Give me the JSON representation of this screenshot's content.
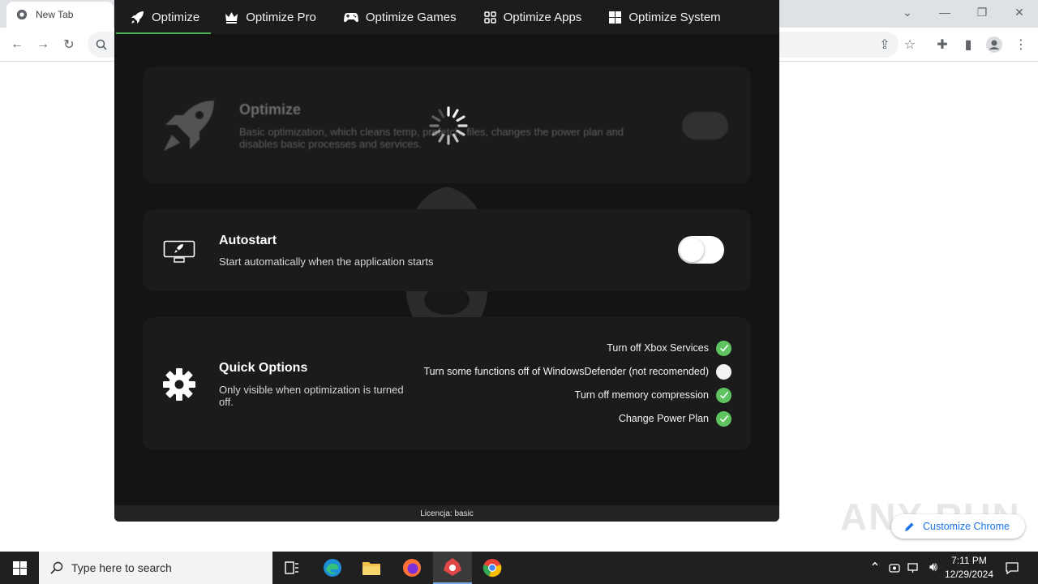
{
  "browser": {
    "tab_title": "New Tab",
    "customize_label": "Customize Chrome",
    "watermark": "ANY RUN"
  },
  "app": {
    "nav": [
      {
        "label": "Optimize",
        "icon": "rocket-icon"
      },
      {
        "label": "Optimize Pro",
        "icon": "crown-icon"
      },
      {
        "label": "Optimize Games",
        "icon": "gamepad-icon"
      },
      {
        "label": "Optimize Apps",
        "icon": "apps-grid-icon"
      },
      {
        "label": "Optimize System",
        "icon": "windows-icon"
      }
    ],
    "optimize_card": {
      "title": "Optimize",
      "desc_line1": "Basic optimization, which cleans temp, prefetch, files, changes the power plan and",
      "desc_line2": "disables basic processes and services."
    },
    "autostart_card": {
      "title": "Autostart",
      "desc": "Start automatically when the application starts"
    },
    "quick_card": {
      "title": "Quick Options",
      "desc_line1": "Only visible when optimization is turned",
      "desc_line2": "off.",
      "options": [
        {
          "label": "Turn off Xbox Services",
          "checked": true
        },
        {
          "label": "Turn some functions off of WindowsDefender (not recomended)",
          "checked": false
        },
        {
          "label": "Turn off memory compression",
          "checked": true
        },
        {
          "label": "Change Power Plan",
          "checked": true
        }
      ]
    },
    "footer": "Licencja: basic",
    "accent_color": "#4caf50",
    "check_color": "#5fc45f"
  },
  "taskbar": {
    "search_placeholder": "Type here to search",
    "time": "7:11 PM",
    "date": "12/29/2024"
  }
}
